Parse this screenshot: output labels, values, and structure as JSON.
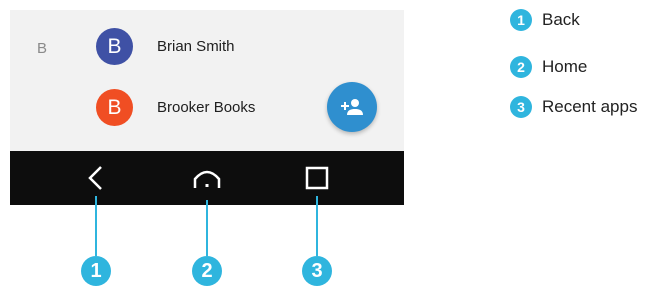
{
  "contacts": {
    "section_letter": "B",
    "items": [
      {
        "initial": "B",
        "name": "Brian Smith",
        "avatar_color": "#3f51a5"
      },
      {
        "initial": "B",
        "name": "Brooker Books",
        "avatar_color": "#f04e23"
      }
    ],
    "fab_icon": "add-contact-icon"
  },
  "navbar": {
    "buttons": [
      {
        "icon": "back-icon",
        "number": "1"
      },
      {
        "icon": "home-icon",
        "number": "2"
      },
      {
        "icon": "recent-apps-icon",
        "number": "3"
      }
    ]
  },
  "legend": [
    {
      "number": "1",
      "label": "Back"
    },
    {
      "number": "2",
      "label": "Home"
    },
    {
      "number": "3",
      "label": "Recent apps"
    }
  ],
  "colors": {
    "accent": "#2fb5de",
    "fab": "#2f8fcf",
    "navbar_bg": "#0d0d0d",
    "list_bg": "#f2f2f2"
  }
}
